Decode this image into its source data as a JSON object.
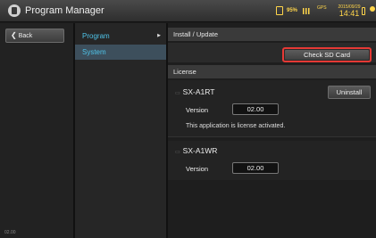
{
  "window": {
    "title": "Program Manager"
  },
  "status": {
    "battery_pct": "95%",
    "gps": "GPS",
    "date": "2015/09/29",
    "time": "14:41"
  },
  "left": {
    "back_label": "Back",
    "footer": "02.00"
  },
  "nav": {
    "items": [
      {
        "label": "Program",
        "arrow": "▶"
      },
      {
        "label": "System"
      }
    ]
  },
  "main": {
    "install_header": "Install / Update",
    "check_sd_label": "Check SD Card",
    "license_header": "License",
    "programs": [
      {
        "name": "SX-A1RT",
        "uninstall_label": "Uninstall",
        "version_label": "Version",
        "version_value": "02.00",
        "status_text": "This application is license activated."
      },
      {
        "name": "SX-A1WR",
        "version_label": "Version",
        "version_value": "02.00"
      }
    ]
  }
}
